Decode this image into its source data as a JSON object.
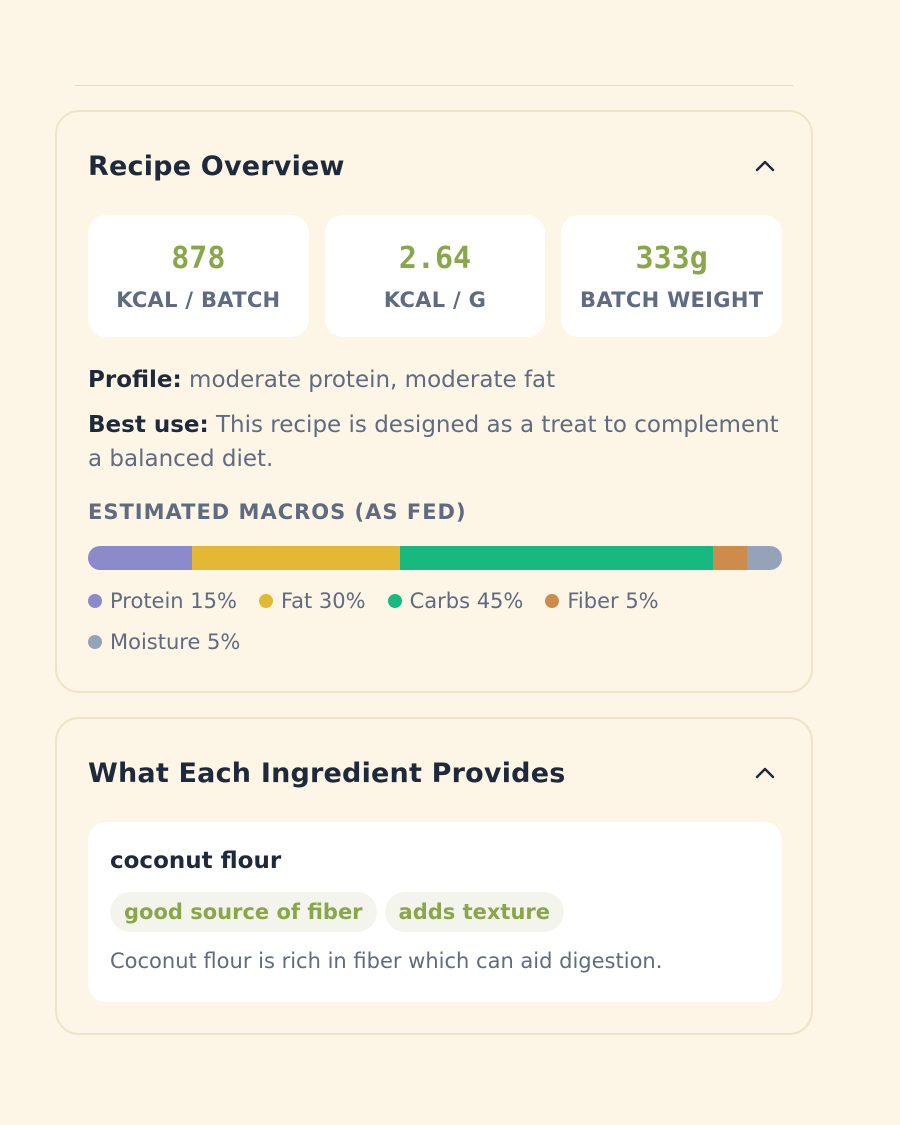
{
  "overview": {
    "title": "Recipe Overview",
    "stats": [
      {
        "value": "878",
        "label": "KCAL / BATCH"
      },
      {
        "value": "2.64",
        "label": "KCAL / G"
      },
      {
        "value": "333g",
        "label": "BATCH WEIGHT"
      }
    ],
    "profile_label": "Profile:",
    "profile_value": "moderate protein, moderate fat",
    "best_use_label": "Best use:",
    "best_use_value": "This recipe is designed as a treat to complement a balanced diet.",
    "macros_heading": "ESTIMATED MACROS (AS FED)",
    "macros": [
      {
        "name": "Protein",
        "percent": 15,
        "label": "Protein 15%",
        "color": "#8b8bcb"
      },
      {
        "name": "Fat",
        "percent": 30,
        "label": "Fat 30%",
        "color": "#e3b834"
      },
      {
        "name": "Carbs",
        "percent": 45,
        "label": "Carbs 45%",
        "color": "#17b981"
      },
      {
        "name": "Fiber",
        "percent": 5,
        "label": "Fiber 5%",
        "color": "#cd8b4c"
      },
      {
        "name": "Moisture",
        "percent": 5,
        "label": "Moisture 5%",
        "color": "#95a3b8"
      }
    ]
  },
  "ingredients": {
    "title": "What Each Ingredient Provides",
    "items": [
      {
        "name": "coconut flour",
        "tags": [
          "good source of fiber",
          "adds texture"
        ],
        "description": "Coconut flour is rich in fiber which can aid digestion."
      }
    ]
  },
  "colors": {
    "accent": "#8aa64a",
    "background": "#fdf5e6",
    "card_border": "#efe3c8",
    "text_dark": "#1e2a3b",
    "text_muted": "#5e6b80"
  },
  "icons": {
    "collapse": "chevron-up-icon"
  }
}
